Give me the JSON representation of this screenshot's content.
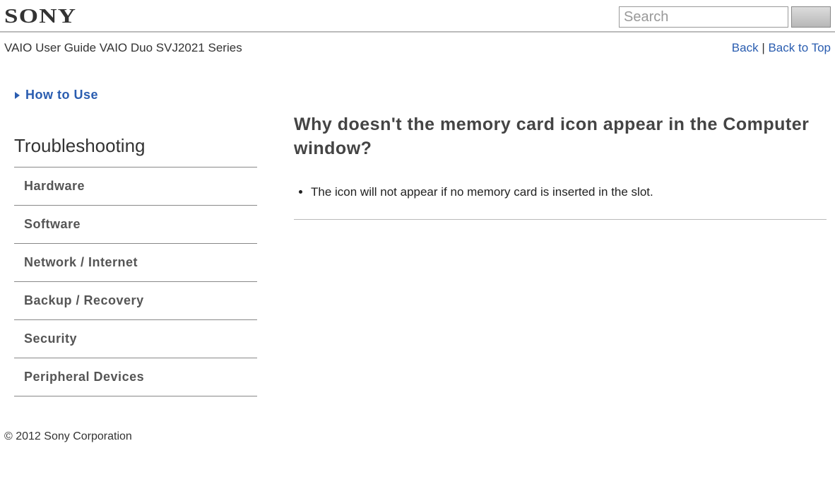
{
  "header": {
    "logo": "SONY",
    "search_placeholder": "Search"
  },
  "subheader": {
    "breadcrumb": "VAIO User Guide VAIO Duo SVJ2021 Series",
    "back_label": "Back",
    "separator": " | ",
    "back_to_top_label": "Back to Top"
  },
  "sidebar": {
    "how_to_use_label": "How to Use",
    "section_title": "Troubleshooting",
    "items": [
      {
        "label": "Hardware"
      },
      {
        "label": "Software"
      },
      {
        "label": "Network / Internet"
      },
      {
        "label": "Backup / Recovery"
      },
      {
        "label": "Security"
      },
      {
        "label": "Peripheral Devices"
      }
    ]
  },
  "article": {
    "title": "Why doesn't the memory card icon appear in the Computer window?",
    "bullets": [
      "The icon will not appear if no memory card is inserted in the slot."
    ]
  },
  "footer": {
    "copyright": "© 2012 Sony Corporation"
  }
}
